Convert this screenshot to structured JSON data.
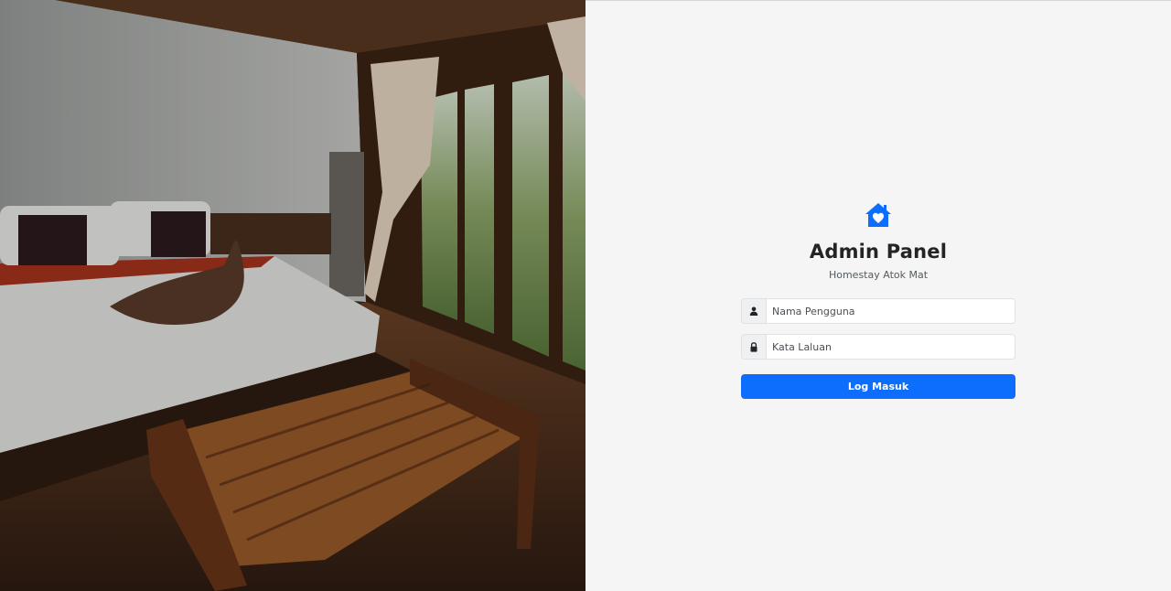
{
  "brand": {
    "icon": "house-heart-icon",
    "accent_color": "#0d6efd"
  },
  "login": {
    "title": "Admin Panel",
    "subtitle": "Homestay Atok Mat",
    "username": {
      "icon": "user-icon",
      "placeholder": "Nama Pengguna",
      "value": ""
    },
    "password": {
      "icon": "lock-icon",
      "placeholder": "Kata Laluan",
      "value": ""
    },
    "submit_label": "Log Masuk"
  },
  "hero_image": {
    "subject": "bedroom-photo"
  }
}
